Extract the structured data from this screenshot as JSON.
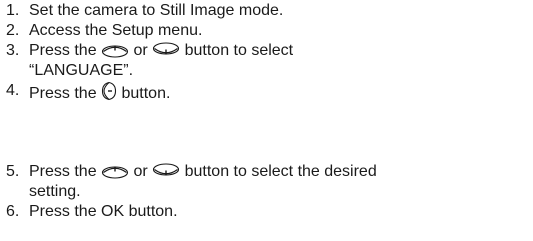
{
  "steps": [
    {
      "num": "1.",
      "text": "Set the camera to Still Image mode."
    },
    {
      "num": "2.",
      "text": "Access the Setup menu."
    },
    {
      "num": "3.",
      "pre": "Press the ",
      "mid": " or ",
      "post": " button to select",
      "cont": "“LANGUAGE”.",
      "icons": [
        "up-button-icon",
        "down-button-icon"
      ]
    },
    {
      "num": "4.",
      "pre": "Press the ",
      "post": " button.",
      "icons": [
        "right-button-icon"
      ]
    },
    {
      "num": "5.",
      "pre": "Press the ",
      "mid": " or ",
      "post": " button to select the desired",
      "cont": "setting.",
      "icons": [
        "up-button-icon",
        "down-button-icon"
      ]
    },
    {
      "num": "6.",
      "text": "Press the OK button."
    }
  ]
}
